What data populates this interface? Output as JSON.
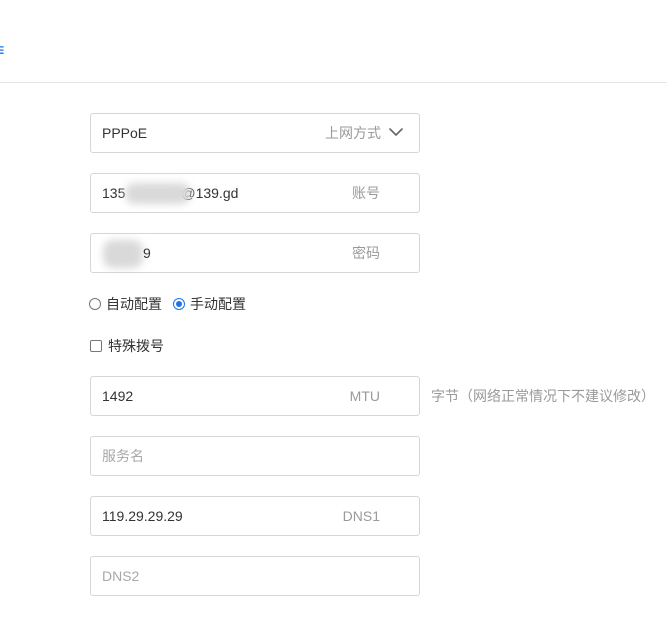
{
  "header": {
    "edge_glyph": "≡"
  },
  "form": {
    "connection_type": {
      "value": "PPPoE",
      "label": "上网方式",
      "icon": "chevron-down-icon"
    },
    "account": {
      "value_start": "135",
      "value_end": "@139.gd",
      "label": "账号"
    },
    "password": {
      "value_end": "9",
      "label": "密码"
    },
    "config_mode": {
      "options": [
        "自动配置",
        "手动配置"
      ],
      "selected": "手动配置"
    },
    "special_dial": {
      "label": "特殊拨号",
      "checked": false
    },
    "mtu": {
      "value": "1492",
      "label": "MTU",
      "hint": "字节（网络正常情况下不建议修改）"
    },
    "service_name": {
      "placeholder": "服务名"
    },
    "dns1": {
      "value": "119.29.29.29",
      "label": "DNS1"
    },
    "dns2": {
      "placeholder": "DNS2"
    }
  },
  "colors": {
    "accent": "#1a73e8",
    "border": "#d6d6d6",
    "muted_text": "#9a9a9a",
    "divider": "#e4e4e4"
  }
}
